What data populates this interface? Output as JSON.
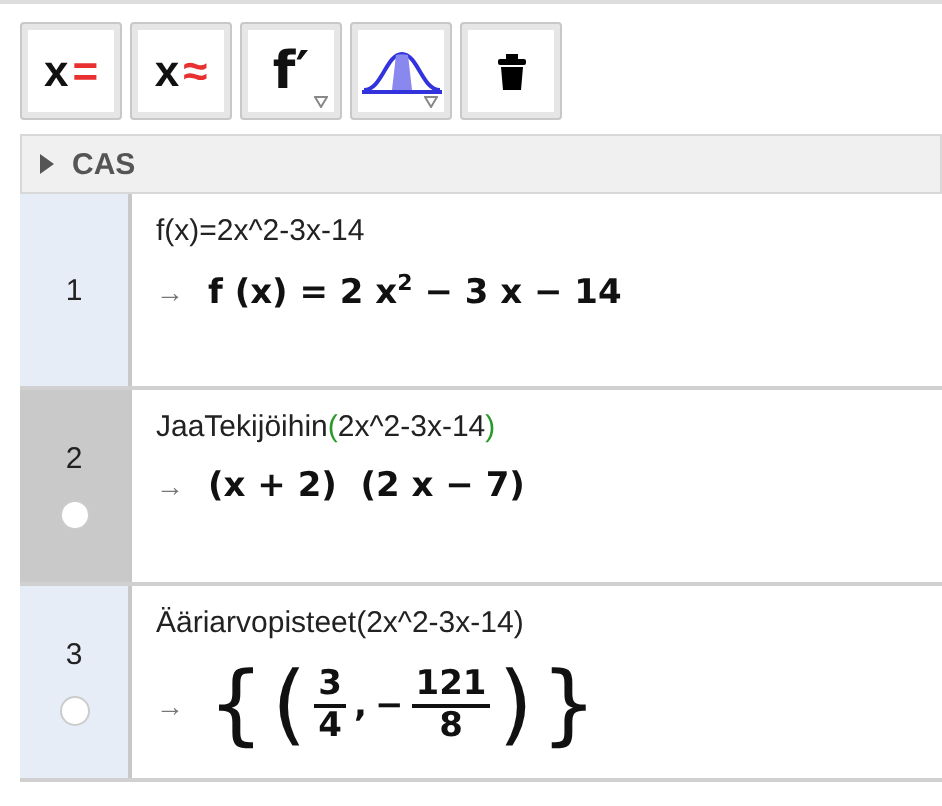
{
  "toolbar": [
    {
      "kind": "symbol",
      "text": "x",
      "symbol": "=",
      "selected": false
    },
    {
      "kind": "symbol",
      "text": "x",
      "symbol": "≈",
      "selected": false
    },
    {
      "kind": "text",
      "text": "f′",
      "menu": true,
      "selected": false
    },
    {
      "kind": "distribution",
      "menu": true,
      "selected": false
    },
    {
      "kind": "trash",
      "selected": false
    }
  ],
  "view_header": {
    "title": "CAS",
    "expanded": false
  },
  "rows": [
    {
      "number": "1",
      "selected": false,
      "input": {
        "text": "f(x)=2x^2-3x-14"
      },
      "arrow": "→",
      "output": [
        {
          "t": "f (x) = 2 x$^{2}$ − 3 x − 14"
        }
      ]
    },
    {
      "number": "2",
      "selected": true,
      "plot_toggle": {
        "on": false
      },
      "input": {
        "command": "JaaTekijöihin",
        "open": "(",
        "args": "2x^2-3x-14",
        "close": ")"
      },
      "arrow": "→",
      "output": [
        {
          "t": "(x + 2)  (2 x − 7)"
        }
      ]
    },
    {
      "number": "3",
      "selected": false,
      "plot_toggle": {
        "on": false
      },
      "input": {
        "command": "Ääriarvopisteet",
        "open": "(",
        "args": "2x^2-3x-14",
        "close": ")"
      },
      "arrow": "→",
      "output": [
        {
          "big": "{"
        },
        {
          "big": "("
        },
        {
          "num": "3",
          "den": "4"
        },
        {
          "t": ","
        },
        {
          "t": "−"
        },
        {
          "num": "121",
          "den": "8"
        },
        {
          "big": ")"
        },
        {
          "big": "}"
        }
      ]
    }
  ]
}
